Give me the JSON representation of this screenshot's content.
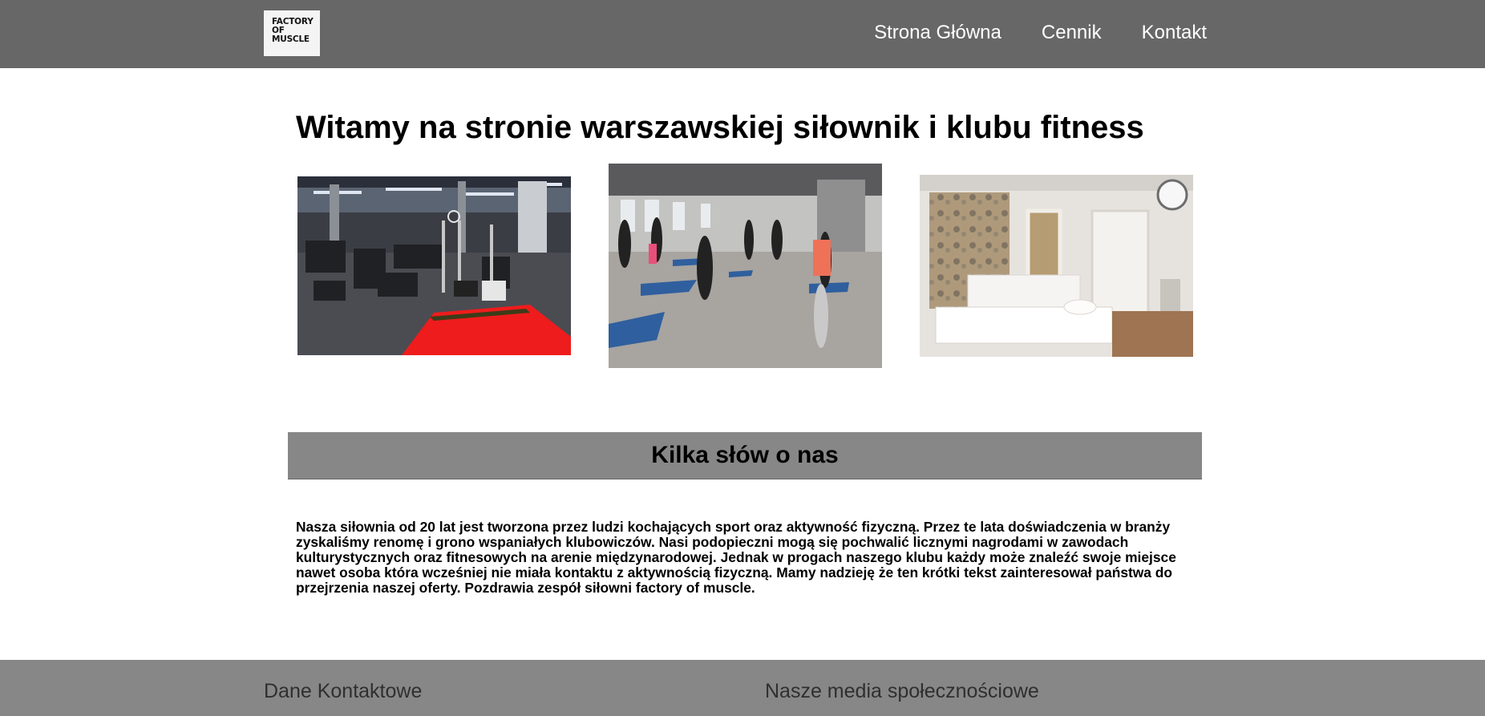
{
  "header": {
    "logo_lines": [
      "FACTORY",
      "OF",
      "MUSCLE"
    ],
    "nav": [
      {
        "label": "Strona Główna"
      },
      {
        "label": "Cennik"
      },
      {
        "label": "Kontakt"
      }
    ]
  },
  "main": {
    "title": "Witamy na stronie warszawskiej siłownik i klubu fitness",
    "photos": [
      {
        "name": "gym-floor-photo"
      },
      {
        "name": "fitness-class-photo"
      },
      {
        "name": "massage-room-photo"
      }
    ]
  },
  "about": {
    "heading": "Kilka słów o nas",
    "text": "Nasza siłownia od 20 lat jest tworzona przez ludzi kochających sport oraz aktywność fizyczną. Przez te lata doświadczenia w branży zyskaliśmy renomę i grono wspaniałych klubowiczów. Nasi podopieczni mogą się pochwalić licznymi nagrodami w zawodach kulturystycznych oraz fitnesowych na arenie międzynarodowej. Jednak w progach naszego klubu każdy może znaleźć swoje miejsce nawet osoba która wcześniej nie miała kontaktu z aktywnością fizyczną. Mamy nadzieję że ten krótki tekst zainteresował państwa do przejrzenia naszej oferty. Pozdrawia zespół siłowni factory of muscle."
  },
  "footer": {
    "contact_heading": "Dane Kontaktowe",
    "social_heading": "Nasze media społecznościowe"
  },
  "colors": {
    "header_bg": "#676767",
    "band_bg": "#878787",
    "footer_bg": "#878787"
  }
}
